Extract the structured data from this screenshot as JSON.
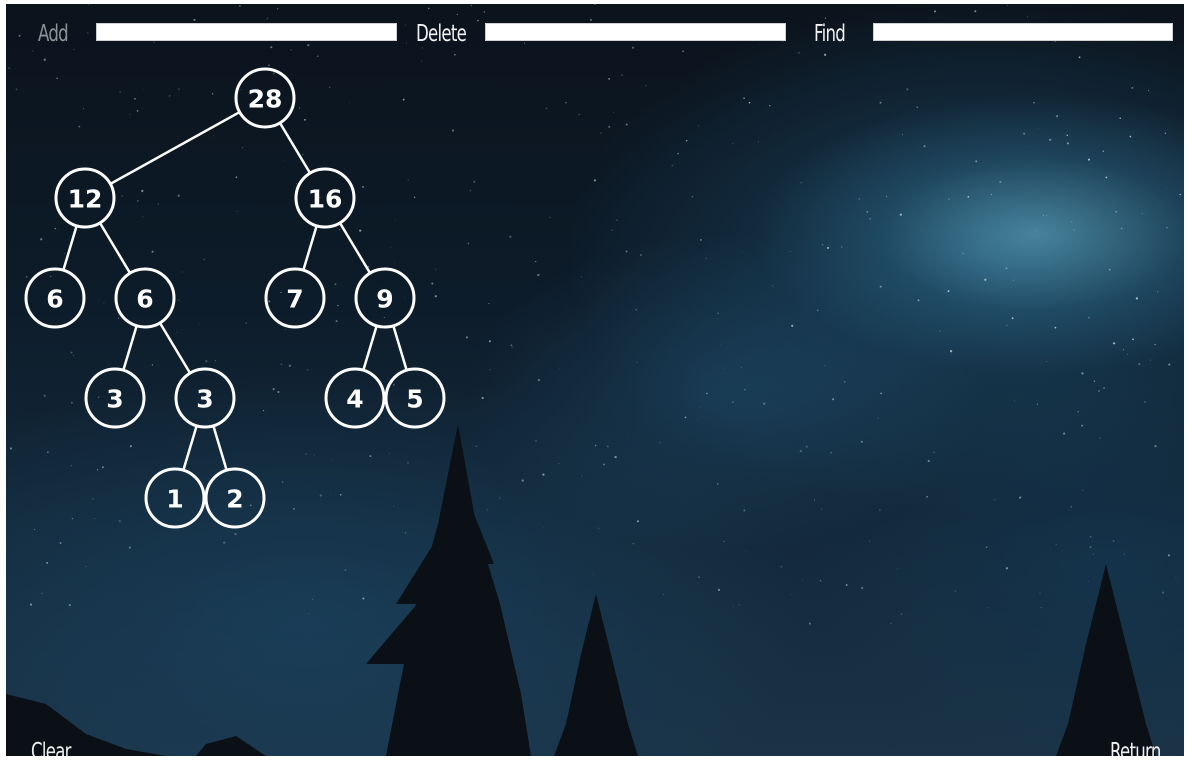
{
  "toolbar": {
    "add_label": "Add",
    "add_value": "",
    "delete_label": "Delete",
    "delete_value": "",
    "find_label": "Find",
    "find_value": ""
  },
  "tree": {
    "nodes": [
      {
        "id": "n28",
        "value": "28"
      },
      {
        "id": "n12",
        "value": "12"
      },
      {
        "id": "n16",
        "value": "16"
      },
      {
        "id": "n6a",
        "value": "6"
      },
      {
        "id": "n6b",
        "value": "6"
      },
      {
        "id": "n7",
        "value": "7"
      },
      {
        "id": "n9",
        "value": "9"
      },
      {
        "id": "n3a",
        "value": "3"
      },
      {
        "id": "n3b",
        "value": "3"
      },
      {
        "id": "n4",
        "value": "4"
      },
      {
        "id": "n5",
        "value": "5"
      },
      {
        "id": "n1",
        "value": "1"
      },
      {
        "id": "n2",
        "value": "2"
      }
    ],
    "edges": [
      [
        "n28",
        "n12"
      ],
      [
        "n28",
        "n16"
      ],
      [
        "n12",
        "n6a"
      ],
      [
        "n12",
        "n6b"
      ],
      [
        "n16",
        "n7"
      ],
      [
        "n16",
        "n9"
      ],
      [
        "n6b",
        "n3a"
      ],
      [
        "n6b",
        "n3b"
      ],
      [
        "n9",
        "n4"
      ],
      [
        "n9",
        "n5"
      ],
      [
        "n3b",
        "n1"
      ],
      [
        "n3b",
        "n2"
      ]
    ]
  },
  "footer": {
    "clear_label": "Clear",
    "return_label": "Return"
  }
}
